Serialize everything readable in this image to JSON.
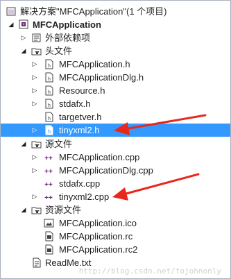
{
  "solution_explorer": {
    "solution": {
      "label": "解决方案\"MFCApplication\"(1 个项目)",
      "icon": "solution-icon"
    },
    "project": {
      "label": "MFCApplication",
      "icon": "project-icon"
    },
    "external_deps": {
      "label": "外部依赖项",
      "icon": "external-dependencies-icon"
    },
    "header_folder": {
      "label": "头文件",
      "items": [
        {
          "label": "MFCApplication.h"
        },
        {
          "label": "MFCApplicationDlg.h"
        },
        {
          "label": "Resource.h"
        },
        {
          "label": "stdafx.h"
        },
        {
          "label": "targetver.h"
        },
        {
          "label": "tinyxml2.h",
          "selected": true
        }
      ]
    },
    "source_folder": {
      "label": "源文件",
      "items": [
        {
          "label": "MFCApplication.cpp"
        },
        {
          "label": "MFCApplicationDlg.cpp"
        },
        {
          "label": "stdafx.cpp"
        },
        {
          "label": "tinyxml2.cpp"
        }
      ]
    },
    "resource_folder": {
      "label": "资源文件",
      "items": [
        {
          "label": "MFCApplication.ico"
        },
        {
          "label": "MFCApplication.rc"
        },
        {
          "label": "MFCApplication.rc2"
        }
      ]
    },
    "readme": {
      "label": "ReadMe.txt"
    }
  },
  "watermark": "http://blog.csdn.net/tojohnonly",
  "colors": {
    "selection": "#3399ff",
    "arrow": "#e8281c",
    "cpp_icon": "#68217a"
  }
}
